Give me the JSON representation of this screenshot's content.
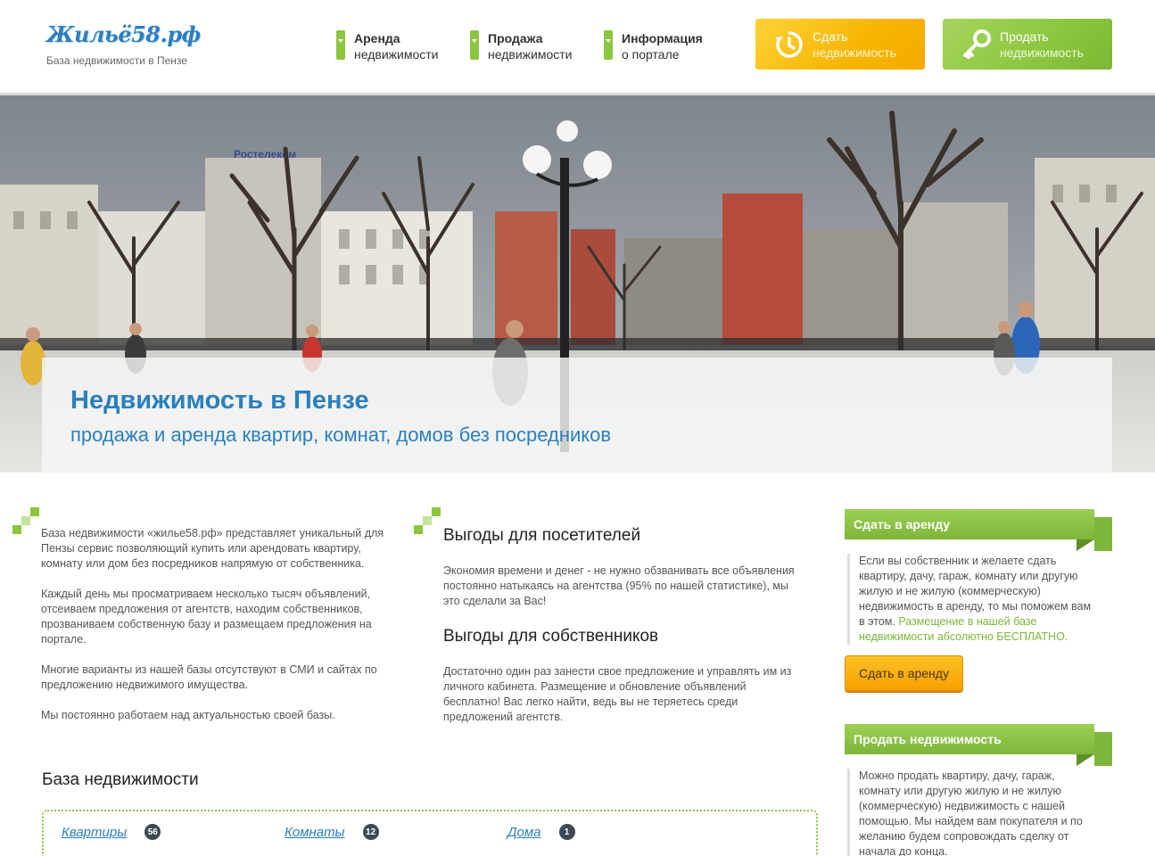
{
  "header": {
    "logo": "Жильё58.рф",
    "tagline": "База недвижимости в Пензе",
    "nav": [
      {
        "line1": "Аренда",
        "line2": "недвижимости"
      },
      {
        "line1": "Продажа",
        "line2": "недвижимости"
      },
      {
        "line1": "Информация",
        "line2": "о портале"
      }
    ],
    "rent_button": {
      "line1": "Сдать",
      "line2": "недвижимость",
      "icon": "clock-arrow-icon",
      "color": "#f7b500"
    },
    "sell_button": {
      "line1": "Продать",
      "line2": "недвижимость",
      "icon": "key-icon",
      "color": "#8cc63f"
    }
  },
  "hero": {
    "title": "Недвижимость в Пензе",
    "subtitle": "продажа и аренда квартир, комнат, домов без посредников",
    "sign": "Ростелеком"
  },
  "intro": {
    "p1": "База недвижимости «жилье58.рф» представляет уникальный для Пензы сервис позволяющий купить или арендовать квартиру, комнату или дом без посредников напрямую от собственника.",
    "p2": "Каждый день мы просматриваем несколько тысяч объявлений, отсеиваем предложения от агентств, находим собственников, прозваниваем собственную базу и размещаем предложения на портале.",
    "p3": "Многие варианты из нашей базы отсутствуют в СМИ и сайтах по предложению недвижимого имущества.",
    "p4": "Мы постоянно работаем над актуальностью своей базы."
  },
  "benefits": {
    "visitors_title": "Выгоды для посетителей",
    "visitors_text": "Экономия времени и денег - не нужно обзванивать все объявления постоянно натыкаясь на агентства (95% по нашей статистике), мы это сделали за Вас!",
    "owners_title": "Выгоды для собственников",
    "owners_text": "Достаточно один раз занести свое предложение и управлять им из личного кабинета. Размещение и обновление объявлений бесплатно! Вас легко найти, ведь вы не теряетесь среди предложений агентств."
  },
  "base": {
    "title": "База недвижимости",
    "categories": [
      {
        "label": "Квартиры",
        "count": "56"
      },
      {
        "label": "Комнаты",
        "count": "12"
      },
      {
        "label": "Дома",
        "count": "1"
      }
    ]
  },
  "sidebar": {
    "rent": {
      "title": "Сдать в аренду",
      "text": "Если вы собственник и желаете сдать квартиру, дачу, гараж, комнату или другую жилую и не жилую (коммерческую) недвижимость в аренду, то мы поможем вам в этом.",
      "highlight": "Размещение в нашей базе недвижимости абсолютно БЕСПЛАТНО.",
      "button": "Сдать в аренду"
    },
    "sell": {
      "title": "Продать недвижимость",
      "text": "Можно продать квартиру, дачу, гараж, комнату или другую жилую и не жилую (коммерческую) недвижимость с нашей помощью. Мы найдем вам покупателя и по желанию будем сопровождать сделку от начала до конца."
    }
  }
}
